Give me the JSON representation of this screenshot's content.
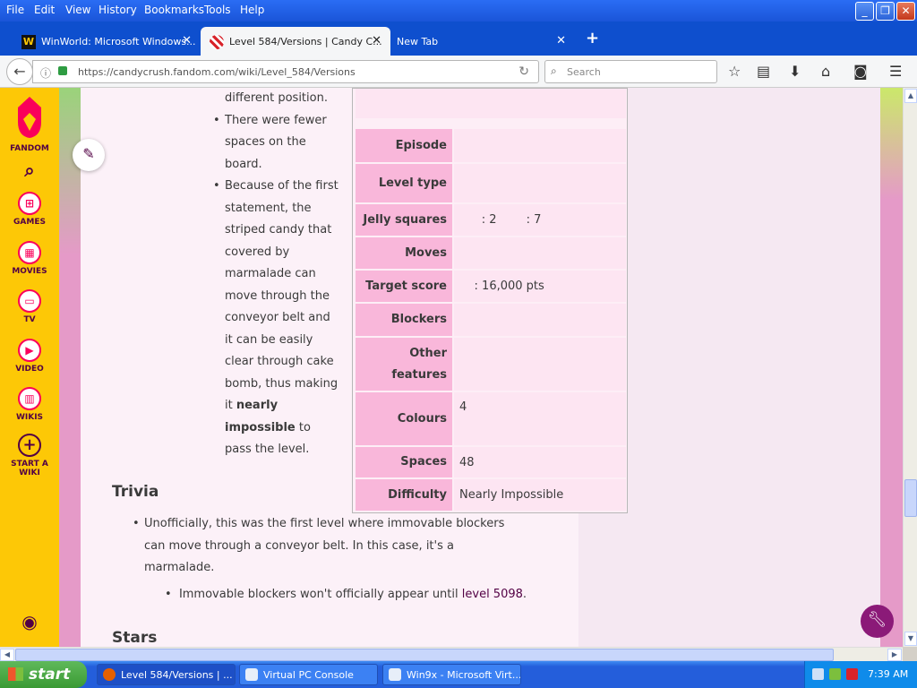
{
  "menubar": {
    "items": [
      "File",
      "Edit",
      "View",
      "History",
      "Bookmarks",
      "Tools",
      "Help"
    ]
  },
  "tabs": [
    {
      "label": "WinWorld: Microsoft Windows...",
      "icon": "winworld-w-icon"
    },
    {
      "label": "Level 584/Versions | Candy C...",
      "icon": "candy-icon"
    },
    {
      "label": "New Tab",
      "icon": ""
    }
  ],
  "navbar": {
    "url": "https://candycrush.fandom.com/wiki/Level_584/Versions",
    "search_placeholder": "Search"
  },
  "rail": [
    {
      "label": "FANDOM",
      "icon": "fandom-logo-icon"
    },
    {
      "label": "GAMES",
      "icon": "gamepad-icon"
    },
    {
      "label": "MOVIES",
      "icon": "film-icon"
    },
    {
      "label": "TV",
      "icon": "tv-icon"
    },
    {
      "label": "VIDEO",
      "icon": "play-icon"
    },
    {
      "label": "WIKIS",
      "icon": "book-icon"
    },
    {
      "label": "START A WIKI",
      "icon": "plus-circle-icon"
    }
  ],
  "article": {
    "bullet_fragment": "different position.",
    "bullets": [
      "There were fewer spaces on the board.",
      "Because of the first statement, the striped candy that covered by marmalade can move through the conveyor belt and it can be easily clear through cake bomb, thus making it",
      "nearly impossible",
      "to pass the level."
    ],
    "trivia_heading": "Trivia",
    "trivia_item": "Unofficially, this was the first level where immovable blockers can move through a conveyor belt. In this case, it's a marmalade.",
    "sub_item_prefix": "Immovable blockers won't officially appear until",
    "sub_item_link": "level 5098",
    "sub_item_suffix": ".",
    "stars_heading": "Stars"
  },
  "infobox": {
    "rows": [
      {
        "label": "Episode",
        "value": ""
      },
      {
        "label": "Level type",
        "value": ""
      },
      {
        "label": "Jelly squares",
        "value": "      : 2        : 7"
      },
      {
        "label": "Moves",
        "value": ""
      },
      {
        "label": "Target score",
        "value": "    : 16,000 pts"
      },
      {
        "label": "Blockers",
        "value": ""
      },
      {
        "label": "Other features",
        "value": ""
      },
      {
        "label": "Colours",
        "value": "4"
      },
      {
        "label": "Spaces",
        "value": "48"
      },
      {
        "label": "Difficulty",
        "value": "Nearly Impossible"
      }
    ]
  },
  "taskbar": {
    "start_label": "start",
    "buttons": [
      "Level 584/Versions | ...",
      "Virtual PC Console",
      "Win9x - Microsoft Virt..."
    ],
    "clock": "7:39 AM"
  },
  "colors": {
    "fandom_yellow": "#fdc806",
    "fandom_pink": "#fa005a",
    "infobox_label": "#f9b7da",
    "accent_purple": "#520044"
  }
}
